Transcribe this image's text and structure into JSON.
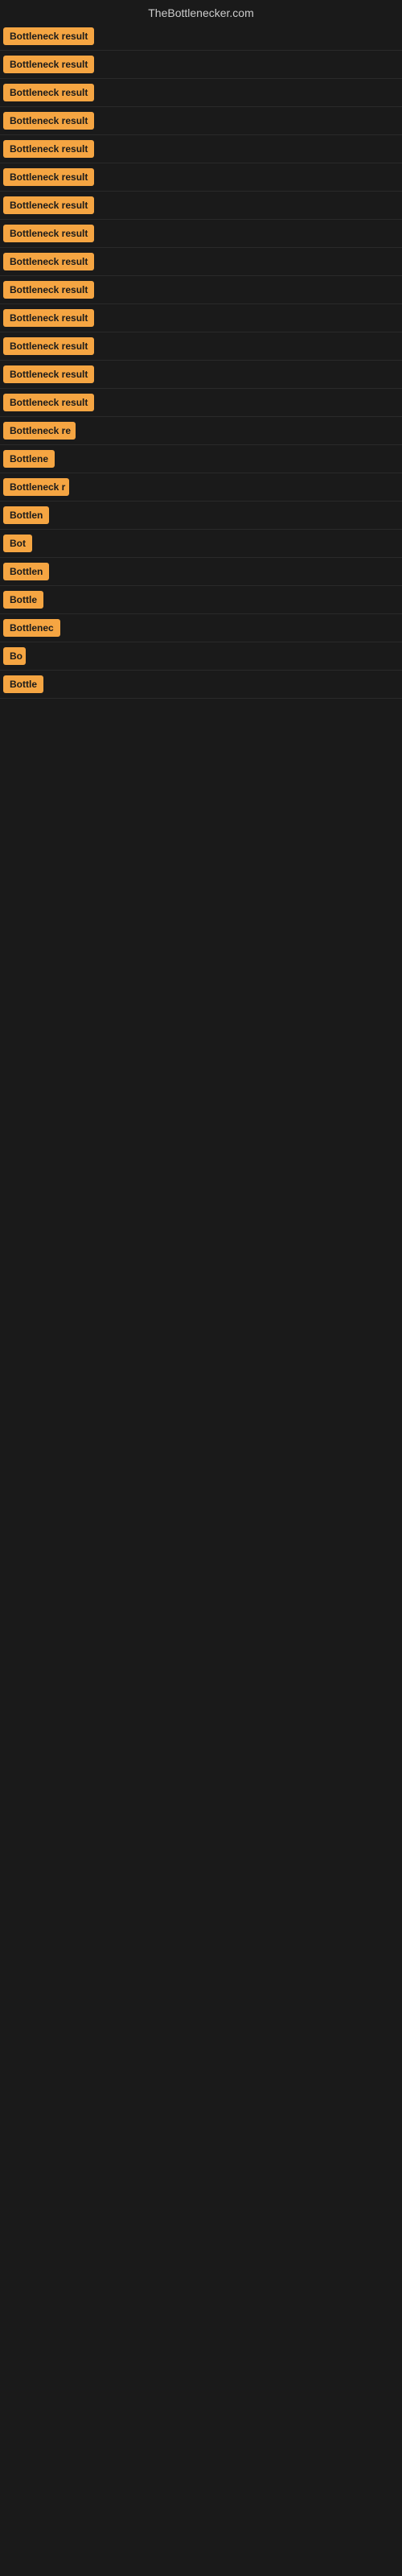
{
  "header": {
    "title": "TheBottlenecker.com"
  },
  "results": [
    {
      "label": "Bottleneck result",
      "width": 120
    },
    {
      "label": "Bottleneck result",
      "width": 120
    },
    {
      "label": "Bottleneck result",
      "width": 120
    },
    {
      "label": "Bottleneck result",
      "width": 120
    },
    {
      "label": "Bottleneck result",
      "width": 120
    },
    {
      "label": "Bottleneck result",
      "width": 120
    },
    {
      "label": "Bottleneck result",
      "width": 120
    },
    {
      "label": "Bottleneck result",
      "width": 120
    },
    {
      "label": "Bottleneck result",
      "width": 120
    },
    {
      "label": "Bottleneck result",
      "width": 120
    },
    {
      "label": "Bottleneck result",
      "width": 120
    },
    {
      "label": "Bottleneck result",
      "width": 120
    },
    {
      "label": "Bottleneck result",
      "width": 120
    },
    {
      "label": "Bottleneck result",
      "width": 120
    },
    {
      "label": "Bottleneck re",
      "width": 90
    },
    {
      "label": "Bottlene",
      "width": 72
    },
    {
      "label": "Bottleneck r",
      "width": 82
    },
    {
      "label": "Bottlen",
      "width": 60
    },
    {
      "label": "Bot",
      "width": 36
    },
    {
      "label": "Bottlen",
      "width": 58
    },
    {
      "label": "Bottle",
      "width": 52
    },
    {
      "label": "Bottlenec",
      "width": 74
    },
    {
      "label": "Bo",
      "width": 28
    },
    {
      "label": "Bottle",
      "width": 50
    }
  ]
}
